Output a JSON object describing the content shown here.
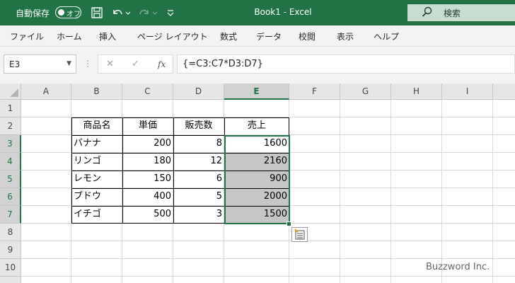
{
  "titlebar": {
    "autosave_label": "自動保存",
    "autosave_state": "オフ",
    "title": "Book1  -  Excel",
    "search_label": "検索",
    "bg_color": "#217346"
  },
  "menu": {
    "items": [
      "ファイル",
      "ホーム",
      "挿入",
      "ページ レイアウト",
      "数式",
      "データ",
      "校閲",
      "表示",
      "ヘルプ"
    ]
  },
  "formula_bar": {
    "name_box": "E3",
    "fx_label": "fx",
    "formula": "{=C3:C7*D3:D7}"
  },
  "sheet": {
    "columns": [
      "A",
      "B",
      "C",
      "D",
      "E",
      "F",
      "G",
      "H",
      "I"
    ],
    "rows": [
      "1",
      "2",
      "3",
      "4",
      "5",
      "6",
      "7",
      "8",
      "9",
      "10"
    ],
    "selected_column": "E",
    "table": {
      "headers": [
        "商品名",
        "単価",
        "販売数",
        "売上"
      ],
      "rows": [
        [
          "バナナ",
          "200",
          "8",
          "1600"
        ],
        [
          "リンゴ",
          "180",
          "12",
          "2160"
        ],
        [
          "レモン",
          "150",
          "6",
          "900"
        ],
        [
          "ブドウ",
          "400",
          "5",
          "2000"
        ],
        [
          "イチゴ",
          "500",
          "3",
          "1500"
        ]
      ]
    }
  },
  "watermark": "Buzzword Inc."
}
